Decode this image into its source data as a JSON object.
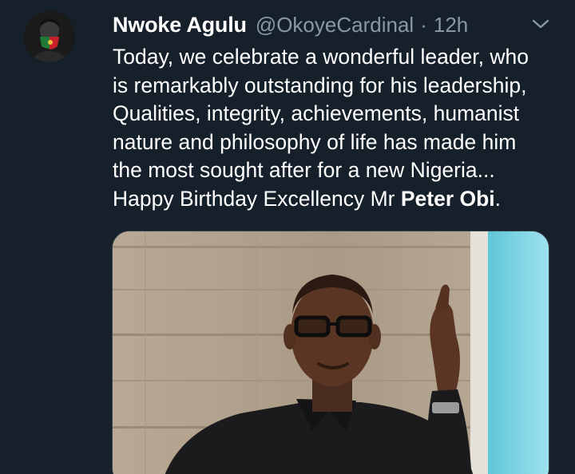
{
  "tweet": {
    "display_name": "Nwoke Agulu",
    "handle": "@OkoyeCardinal",
    "separator": "·",
    "time": "12h",
    "body_lines": [
      "Today, we celebrate a wonderful leader, who",
      "is remarkably outstanding for his leadership,",
      "Qualities, integrity, achievements, humanist",
      "nature and philosophy of life has made him",
      "the most sought after for a new Nigeria..."
    ],
    "last_line_prefix": "Happy Birthday Excellency Mr ",
    "last_line_bold": "Peter Obi",
    "last_line_suffix": ".",
    "avatar_icon": "user-avatar",
    "menu_icon": "chevron-down-icon",
    "media_icon": "photo"
  },
  "colors": {
    "background": "#15202b",
    "primary_text": "#ffffff",
    "secondary_text": "#8899a6",
    "border": "#38444d"
  }
}
